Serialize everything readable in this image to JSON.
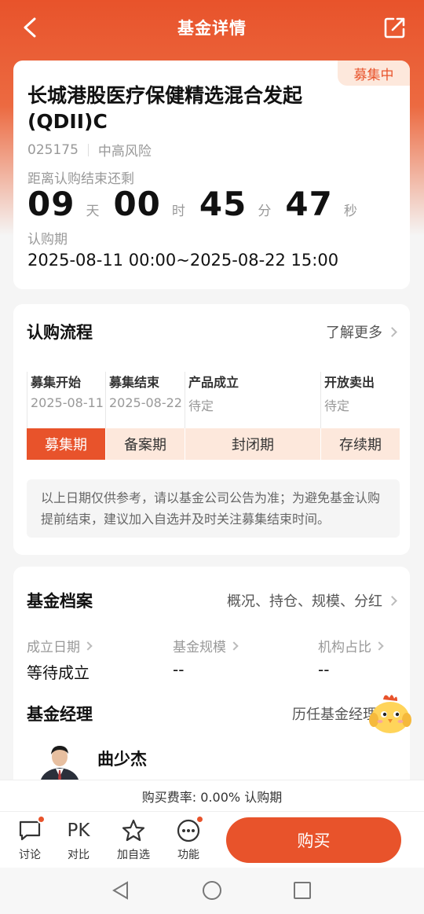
{
  "header": {
    "title": "基金详情"
  },
  "fund": {
    "badge": "募集中",
    "name": "长城港股医疗保健精选混合发起(QDII)C",
    "code": "025175",
    "risk": "中高风险",
    "countdown_label": "距离认购结束还剩",
    "countdown": {
      "days": "09",
      "days_unit": "天",
      "hours": "00",
      "hours_unit": "时",
      "minutes": "45",
      "minutes_unit": "分",
      "seconds": "47",
      "seconds_unit": "秒"
    },
    "period_label": "认购期",
    "period_value": "2025-08-11 00:00~2025-08-22 15:00"
  },
  "process": {
    "title": "认购流程",
    "more": "了解更多",
    "steps": [
      {
        "title": "募集开始",
        "date": "2025-08-11"
      },
      {
        "title": "募集结束",
        "date": "2025-08-22"
      },
      {
        "title": "产品成立",
        "date": "待定"
      },
      {
        "title": "开放卖出",
        "date": "待定"
      }
    ],
    "phases": [
      "募集期",
      "备案期",
      "封闭期",
      "存续期"
    ],
    "active_phase": "募集期",
    "notice": "以上日期仅供参考，请以基金公司公告为准；为避免基金认购提前结束，建议加入自选并及时关注募集结束时间。"
  },
  "profile": {
    "title": "基金档案",
    "links": "概况、持仓、规模、分红",
    "stats": [
      {
        "label": "成立日期",
        "value": "等待成立"
      },
      {
        "label": "基金规模",
        "value": "--"
      },
      {
        "label": "机构占比",
        "value": "--"
      }
    ],
    "manager_title": "基金经理",
    "manager_link": "历任基金经理",
    "manager_name": "曲少杰"
  },
  "fee": {
    "text": "购买费率: 0.00% 认购期"
  },
  "toolbar": {
    "discuss": "讨论",
    "compare_icon": "PK",
    "compare": "对比",
    "watchlist": "加自选",
    "functions": "功能",
    "buy": "购买"
  },
  "colors": {
    "accent": "#e8532b",
    "accent_light": "#fde8dc"
  }
}
